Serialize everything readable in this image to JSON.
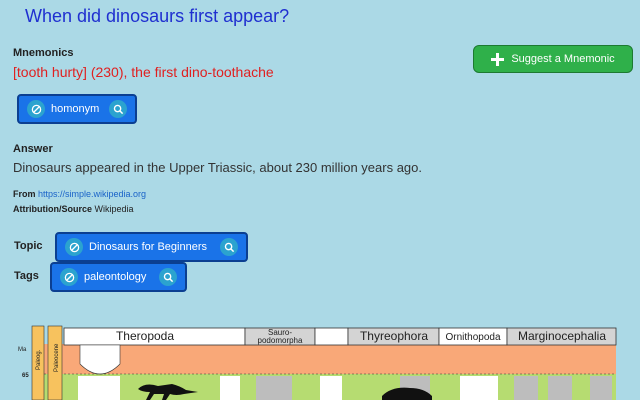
{
  "question": "When did dinosaurs first appear?",
  "mnemonics": {
    "label": "Mnemonics",
    "text": "[tooth hurty] (230), the first dino-toothache",
    "suggest_button": "Suggest a Mnemonic",
    "chip": "homonym"
  },
  "answer": {
    "label": "Answer",
    "text": "Dinosaurs appeared in the Upper Triassic, about 230 million years ago."
  },
  "source": {
    "from_label": "From",
    "from_url": "https://simple.wikipedia.org",
    "attribution_label": "Attribution/Source",
    "attribution": "Wikipedia"
  },
  "topic": {
    "label": "Topic",
    "chip": "Dinosaurs for Beginners"
  },
  "tags": {
    "label": "Tags",
    "chip": "paleontology"
  },
  "figure": {
    "groups": [
      "Theropoda",
      "Sauro-podomorpha",
      "Thyreophora",
      "Ornithopoda",
      "Marginocephalia"
    ],
    "group_line1": "Sauro-",
    "group_line2": "podomorpha",
    "side_labels": [
      "Paleog.",
      "Paleocene"
    ],
    "ma_label": "Ma",
    "tick_label": "65",
    "colors": {
      "orange": "#f9a878",
      "green": "#b6dc71",
      "grey": "#bdbdbd"
    }
  }
}
